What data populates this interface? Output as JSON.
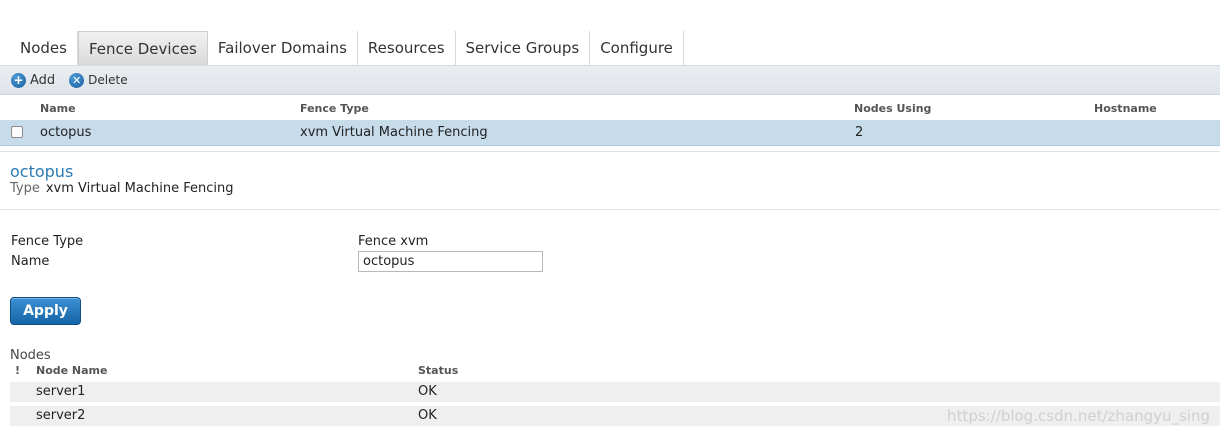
{
  "tabs": [
    {
      "label": "Nodes",
      "active": false
    },
    {
      "label": "Fence Devices",
      "active": true
    },
    {
      "label": "Failover Domains",
      "active": false
    },
    {
      "label": "Resources",
      "active": false
    },
    {
      "label": "Service Groups",
      "active": false
    },
    {
      "label": "Configure",
      "active": false
    }
  ],
  "toolbar": {
    "add_label": "Add",
    "delete_label": "Delete",
    "add_icon": "plus-circle-icon",
    "delete_icon": "x-circle-icon"
  },
  "devices_table": {
    "columns": [
      "Name",
      "Fence Type",
      "Nodes Using",
      "Hostname"
    ],
    "rows": [
      {
        "name": "octopus",
        "fence_type": "xvm Virtual Machine Fencing",
        "nodes_using": "2",
        "hostname": ""
      }
    ]
  },
  "detail": {
    "title": "octopus",
    "type_label": "Type",
    "type_value": "xvm Virtual Machine Fencing",
    "fence_type_label": "Fence Type",
    "fence_type_value": "Fence xvm",
    "name_label": "Name",
    "name_value": "octopus",
    "apply_label": "Apply"
  },
  "nodes": {
    "title": "Nodes",
    "flag_header": "!",
    "columns": [
      "Node Name",
      "Status"
    ],
    "rows": [
      {
        "name": "server1",
        "status": "OK"
      },
      {
        "name": "server2",
        "status": "OK"
      }
    ]
  },
  "watermark": "https://blog.csdn.net/zhangyu_sing",
  "colors": {
    "accent": "#2a7bb5",
    "selected_row": "#c7dceb",
    "button": "#1a6eb3"
  }
}
